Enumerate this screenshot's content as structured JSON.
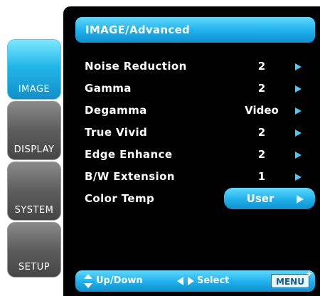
{
  "sidebar": {
    "tabs": [
      {
        "label": "IMAGE",
        "active": true
      },
      {
        "label": "DISPLAY",
        "active": false
      },
      {
        "label": "SYSTEM",
        "active": false
      },
      {
        "label": "SETUP",
        "active": false
      }
    ]
  },
  "header": {
    "title": "IMAGE/Advanced"
  },
  "settings": [
    {
      "label": "Noise Reduction",
      "value": "2"
    },
    {
      "label": "Gamma",
      "value": "2"
    },
    {
      "label": "Degamma",
      "value": "Video"
    },
    {
      "label": "True Vivid",
      "value": "2"
    },
    {
      "label": "Edge Enhance",
      "value": "2"
    },
    {
      "label": "B/W Extension",
      "value": "1"
    },
    {
      "label": "Color Temp",
      "value": "User",
      "selected": true
    }
  ],
  "footer": {
    "updown_label": "Up/Down",
    "select_label": "Select",
    "menu_label": "MENU",
    "menu_badge": "+"
  },
  "colors": {
    "accent": "#1eb0ea",
    "panel": "#000000",
    "inactive_tab": "#5d5d5d"
  }
}
